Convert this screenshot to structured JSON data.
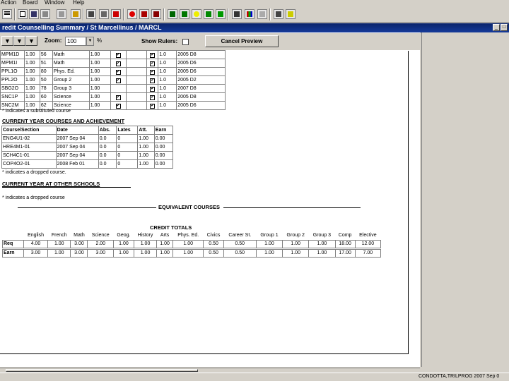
{
  "menu": [
    "Action",
    "Board",
    "Window",
    "Help"
  ],
  "toolbar_icons": [
    "list-icon",
    "edit-icon",
    "save-icon",
    "print-icon",
    "lock-icon",
    "clipboard-icon",
    "report-icon",
    "print-preview-icon",
    "flag-icon",
    "apple-icon",
    "people-icon",
    "group-icon",
    "chart-icon",
    "graph-icon",
    "smiley-icon",
    "filter-icon",
    "export-icon",
    "ruler-icon",
    "bar-chart-icon",
    "document-icon",
    "edit-note-icon",
    "help-icon"
  ],
  "window": {
    "title": "redit Counselling Summary / St Marcellinus / MARCL"
  },
  "preview": {
    "zoom_label": "Zoom:",
    "zoom_value": "100",
    "zoom_unit": "%",
    "show_rulers": "Show Rulers:",
    "cancel": "Cancel Preview"
  },
  "top_courses": {
    "rows": [
      [
        "MPM1D",
        "1.00",
        "56",
        "Math",
        "1.00",
        "✔",
        "",
        "✔",
        "1.0",
        "2005 D8"
      ],
      [
        "MPM1I",
        "1.00",
        "51",
        "Math",
        "1.00",
        "✔",
        "",
        "✔",
        "1.0",
        "2005 D6"
      ],
      [
        "PPL1O",
        "1.00",
        "80",
        "Phys. Ed.",
        "1.00",
        "✔",
        "",
        "✔",
        "1.0",
        "2005 D6"
      ],
      [
        "PPL2O",
        "1.00",
        "50",
        "Group 2",
        "1.00",
        "✔",
        "",
        "✔",
        "1.0",
        "2005 D2"
      ],
      [
        "SBG2O",
        "1.00",
        "78",
        "Group 3",
        "1.00",
        "",
        "",
        "✔",
        "1.0",
        "2007 D8"
      ],
      [
        "SNC1P",
        "1.00",
        "60",
        "Science",
        "1.00",
        "✔",
        "",
        "✔",
        "1.0",
        "2005 D8"
      ],
      [
        "SNC2M",
        "1.00",
        "62",
        "Science",
        "1.00",
        "✔",
        "",
        "✔",
        "1.0",
        "2005 D6"
      ]
    ],
    "note": "* indicates a substituted course"
  },
  "current_year": {
    "heading": "CURRENT YEAR COURSES AND ACHIEVEMENT",
    "headers": [
      "Course/Section",
      "Date",
      "Abs.",
      "Lates",
      "Att.",
      "Earn"
    ],
    "rows": [
      [
        "ENG4U1-02",
        "2007 Sep 04",
        "0.0",
        "0",
        "1.00",
        "0.00"
      ],
      [
        "HRE4M1-01",
        "2007 Sep 04",
        "0.0",
        "0",
        "1.00",
        "0.00"
      ],
      [
        "SCH4C1-01",
        "2007 Sep 04",
        "0.0",
        "0",
        "1.00",
        "0.00"
      ],
      [
        "COP4O2-01",
        "2008 Feb 01",
        "0.0",
        "0",
        "1.00",
        "0.00"
      ]
    ],
    "note": "* indicates a dropped course."
  },
  "other_schools": {
    "heading": "CURRENT YEAR AT OTHER SCHOOLS",
    "note": "* indicates a dropped course"
  },
  "equivalent": {
    "heading": "EQUIVALENT COURSES"
  },
  "credit_totals": {
    "heading": "CREDIT TOTALS",
    "columns": [
      "English",
      "French",
      "Math",
      "Science",
      "Geog.",
      "History",
      "Arts",
      "Phys. Ed.",
      "Civics",
      "Career St.",
      "Group 1",
      "Group 2",
      "Group 3",
      "Comp",
      "Elective"
    ],
    "req_label": "Req",
    "req": [
      "4.00",
      "1.00",
      "3.00",
      "2.00",
      "1.00",
      "1.00",
      "1.00",
      "1.00",
      "0.50",
      "0.50",
      "1.00",
      "1.00",
      "1.00",
      "18.00",
      "12.00"
    ],
    "earn_label": "Earn",
    "earn": [
      "3.00",
      "1.00",
      "3.00",
      "3.00",
      "1.00",
      "1.00",
      "1.00",
      "1.00",
      "0.50",
      "0.50",
      "1.00",
      "1.00",
      "1.00",
      "17.00",
      "7.00"
    ]
  },
  "status": {
    "right": "CONDOTTA,TRILPROG 2007 Sep 0"
  }
}
